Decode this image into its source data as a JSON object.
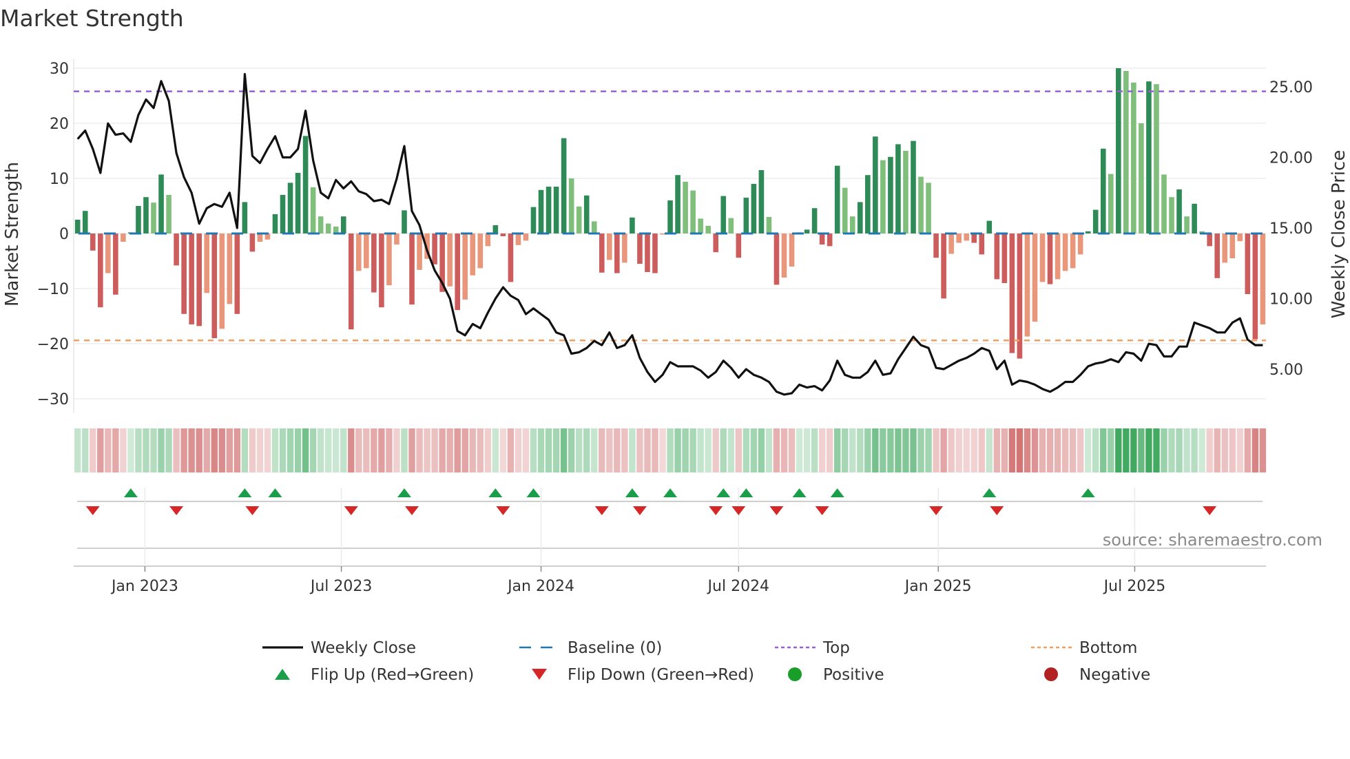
{
  "chart_data": {
    "type": "bar",
    "title": "Market Strength",
    "ylabel": "Market Strength",
    "ylabel_right": "Weekly Close Price",
    "ylim": [
      -32,
      31.5
    ],
    "ylim_right": [
      2.9,
      26.3
    ],
    "yticks": [
      30,
      20,
      10,
      0,
      -10,
      -20,
      -30
    ],
    "yticks_labels": [
      "30",
      "20",
      "10",
      "0",
      "−10",
      "−20",
      "−30"
    ],
    "yticks_right": [
      25,
      20,
      15,
      10,
      5
    ],
    "yticks_right_labels": [
      "25.00",
      "20.00",
      "15.00",
      "10.00",
      "5.00"
    ],
    "x_start": "2022-10-31",
    "x_step_days": 7,
    "xticks": [
      {
        "date": "2023-01-01",
        "label": "Jan 2023"
      },
      {
        "date": "2023-07-01",
        "label": "Jul 2023"
      },
      {
        "date": "2024-01-01",
        "label": "Jan 2024"
      },
      {
        "date": "2024-07-01",
        "label": "Jul 2024"
      },
      {
        "date": "2025-01-01",
        "label": "Jan 2025"
      },
      {
        "date": "2025-07-01",
        "label": "Jul 2025"
      }
    ],
    "top_level": 25.8,
    "bottom_level": -19.4,
    "baseline": 0,
    "strength": [
      2.5,
      4.1,
      -3.1,
      -13.4,
      -7.2,
      -11.1,
      -1.5,
      0.2,
      5.0,
      6.6,
      5.6,
      10.7,
      7.0,
      -5.8,
      -14.6,
      -16.5,
      -16.8,
      -10.8,
      -19.0,
      -17.3,
      -12.8,
      -14.6,
      5.7,
      -3.3,
      -1.5,
      -1.1,
      3.5,
      7.0,
      9.2,
      11.0,
      17.7,
      8.4,
      3.1,
      1.8,
      1.25,
      3.1,
      -17.4,
      -6.8,
      -6.3,
      -10.7,
      -13.4,
      -9.4,
      -2.0,
      4.2,
      -12.9,
      -6.6,
      -4.6,
      -5.6,
      -10.6,
      -9.6,
      -13.9,
      -12.0,
      -7.6,
      -6.3,
      -2.3,
      1.5,
      -0.5,
      -8.8,
      -2.1,
      -1.3,
      4.8,
      7.9,
      8.5,
      8.5,
      17.3,
      10.0,
      4.9,
      6.9,
      2.2,
      -7.1,
      -4.8,
      -7.2,
      -5.3,
      2.9,
      -5.5,
      -7.0,
      -7.2,
      -0.2,
      6.0,
      10.6,
      9.4,
      7.8,
      2.7,
      1.4,
      -3.4,
      6.8,
      2.8,
      -4.4,
      6.5,
      9.0,
      11.5,
      3.0,
      -9.3,
      -8.0,
      -6.0,
      0.2,
      0.7,
      4.6,
      -2.0,
      -2.3,
      12.3,
      8.3,
      3.1,
      5.7,
      10.6,
      17.6,
      13.3,
      13.9,
      16.2,
      15.0,
      16.8,
      10.3,
      9.2,
      -4.4,
      -11.8,
      -3.7,
      -1.7,
      -1.3,
      -1.7,
      -3.8,
      2.3,
      -8.3,
      -9.0,
      -21.7,
      -22.7,
      -18.7,
      -16.0,
      -8.8,
      -9.2,
      -8.3,
      -6.8,
      -6.3,
      -3.8,
      0.4,
      4.3,
      15.4,
      10.8,
      30.0,
      29.5,
      27.4,
      20.0,
      27.6,
      27.1,
      10.7,
      6.6,
      8.0,
      3.1,
      5.4,
      0.4,
      -2.3,
      -8.1,
      -5.3,
      -4.5,
      -1.4,
      -11.0,
      -19.2,
      -16.5
    ],
    "close": [
      21.3,
      21.9,
      20.6,
      18.9,
      22.4,
      21.6,
      21.7,
      21.1,
      23.0,
      24.1,
      23.5,
      25.4,
      24.0,
      20.3,
      18.6,
      17.5,
      15.3,
      16.4,
      16.7,
      16.5,
      17.5,
      15.0,
      25.9,
      20.1,
      19.6,
      20.6,
      21.5,
      20.0,
      20.0,
      20.6,
      23.3,
      19.8,
      17.5,
      17.1,
      18.4,
      17.8,
      18.3,
      17.6,
      17.4,
      16.9,
      17.0,
      16.7,
      18.5,
      20.8,
      16.2,
      15.2,
      13.4,
      12.0,
      11.1,
      10.0,
      7.7,
      7.4,
      8.2,
      7.9,
      9.0,
      10.0,
      10.8,
      10.2,
      9.9,
      8.9,
      9.3,
      8.9,
      8.5,
      7.6,
      7.4,
      6.1,
      6.2,
      6.5,
      7.0,
      6.7,
      7.6,
      6.5,
      6.7,
      7.4,
      5.8,
      4.8,
      4.1,
      4.6,
      5.5,
      5.2,
      5.2,
      5.2,
      4.9,
      4.4,
      4.8,
      5.6,
      5.1,
      4.4,
      5.0,
      4.6,
      4.4,
      4.1,
      3.4,
      3.2,
      3.3,
      3.9,
      3.7,
      3.8,
      3.5,
      4.2,
      5.6,
      4.6,
      4.4,
      4.4,
      4.8,
      5.6,
      4.6,
      4.7,
      5.7,
      6.5,
      7.3,
      6.7,
      6.5,
      5.1,
      5.0,
      5.3,
      5.6,
      5.8,
      6.1,
      6.5,
      6.3,
      5.0,
      5.6,
      3.9,
      4.2,
      4.1,
      3.9,
      3.6,
      3.4,
      3.7,
      4.1,
      4.1,
      4.6,
      5.2,
      5.4,
      5.5,
      5.7,
      5.5,
      6.2,
      6.1,
      5.6,
      6.8,
      6.7,
      5.9,
      5.9,
      6.6,
      6.6,
      8.3,
      8.1,
      7.9,
      7.6,
      7.6,
      8.3,
      8.6,
      7.1,
      6.7,
      6.7
    ],
    "colors": {
      "pos_rising": "#2e8b57",
      "pos_falling": "#7fbf7b",
      "neg_falling": "#cd5c5c",
      "neg_rising": "#e9967a",
      "close": "#111111",
      "baseline": "#1f77b4",
      "top": "#9a5fd6",
      "bottom": "#f0a060",
      "flip_up": "#1a9e4a",
      "flip_down": "#d62728",
      "positive": "#1a9e2a",
      "negative": "#b22222"
    },
    "legend": [
      {
        "key": "close",
        "label": "Weekly Close",
        "marker": "line"
      },
      {
        "key": "baseline",
        "label": "Baseline (0)",
        "marker": "dashed"
      },
      {
        "key": "top",
        "label": "Top",
        "marker": "dotted"
      },
      {
        "key": "bottom",
        "label": "Bottom",
        "marker": "dotted"
      },
      {
        "key": "flip_up",
        "label": "Flip Up (Red→Green)",
        "marker": "triangle-up"
      },
      {
        "key": "flip_down",
        "label": "Flip Down (Green→Red)",
        "marker": "triangle-down"
      },
      {
        "key": "positive",
        "label": "Positive",
        "marker": "circle"
      },
      {
        "key": "negative",
        "label": "Negative",
        "marker": "circle"
      }
    ],
    "legend_position": "bottom",
    "source": "source: sharemaestro.com"
  }
}
